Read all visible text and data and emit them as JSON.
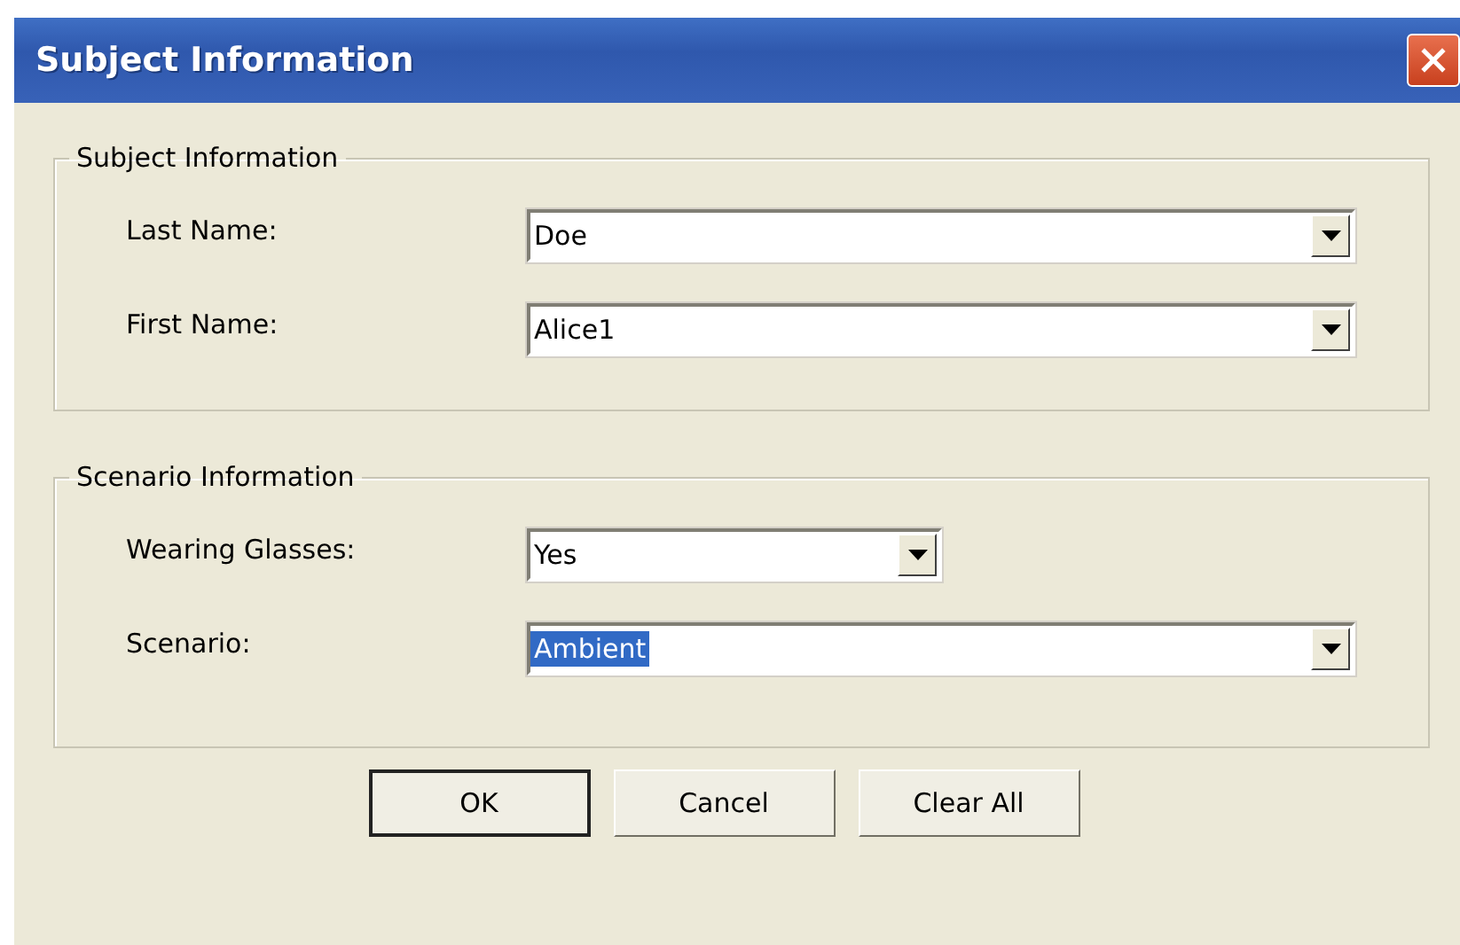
{
  "window": {
    "title": "Subject Information"
  },
  "groups": [
    {
      "title": "Subject Information",
      "fields": [
        {
          "label": "Last Name:",
          "value": "Doe",
          "kind": "wide",
          "text_selected": false
        },
        {
          "label": "First Name:",
          "value": "Alice1",
          "kind": "wide",
          "text_selected": false
        }
      ]
    },
    {
      "title": "Scenario Information",
      "fields": [
        {
          "label": "Wearing Glasses:",
          "value": "Yes",
          "kind": "short",
          "text_selected": false
        },
        {
          "label": "Scenario:",
          "value": "Ambient",
          "kind": "wide",
          "text_selected": true
        }
      ]
    }
  ],
  "buttons": [
    {
      "label": "OK",
      "default": true
    },
    {
      "label": "Cancel",
      "default": false
    },
    {
      "label": "Clear All",
      "default": false
    }
  ]
}
